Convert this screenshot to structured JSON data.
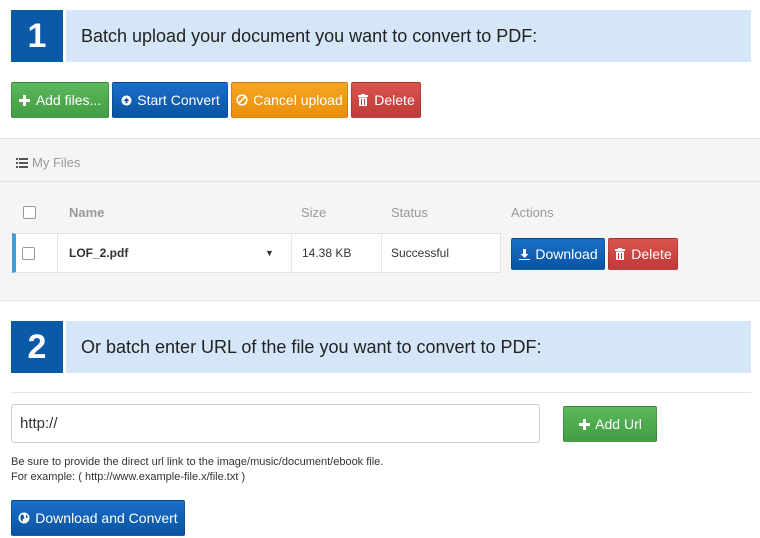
{
  "step1": {
    "number": "1",
    "text": "Batch upload your document you want to convert to PDF:"
  },
  "toolbar": {
    "add_files": "Add files...",
    "start_convert": "Start Convert",
    "cancel_upload": "Cancel upload",
    "delete": "Delete"
  },
  "files_panel": {
    "title": "My Files",
    "headers": {
      "name": "Name",
      "size": "Size",
      "status": "Status",
      "actions": "Actions"
    },
    "rows": [
      {
        "name": "LOF_2.pdf",
        "size": "14.38 KB",
        "status": "Successful",
        "download": "Download",
        "delete": "Delete"
      }
    ]
  },
  "step2": {
    "number": "2",
    "text": "Or batch enter URL of the file you want to convert to PDF:"
  },
  "url": {
    "value": "http://",
    "add_url": "Add Url",
    "hint1": "Be sure to provide the direct url link to the image/music/document/ebook file.",
    "hint2": "For example: ( http://www.example-file.x/file.txt )",
    "download_convert": "Download and Convert"
  },
  "icons": {
    "step_color": "#0a5aa8",
    "step_bg": "#d4e6f7",
    "green": "#5cb85c",
    "blue": "#0a53a0",
    "orange": "#f5a623",
    "red": "#d9534f"
  }
}
